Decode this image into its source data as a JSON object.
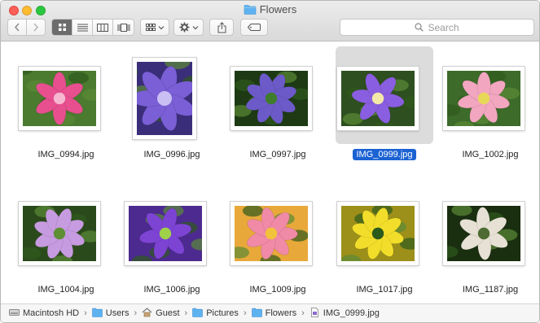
{
  "window": {
    "title": "Flowers"
  },
  "toolbar": {
    "view_modes": [
      "icon-view",
      "list-view",
      "column-view",
      "coverflow-view"
    ],
    "active_view": "icon-view"
  },
  "search": {
    "placeholder": "Search"
  },
  "files": [
    {
      "name": "IMG_0994.jpg",
      "selected": false,
      "orientation": "landscape",
      "palette": [
        "#e74f8f",
        "#f6b6cf",
        "#4a7b2f"
      ]
    },
    {
      "name": "IMG_0996.jpg",
      "selected": false,
      "orientation": "portrait",
      "palette": [
        "#7a5fd6",
        "#c9bff3",
        "#3a2e7a"
      ]
    },
    {
      "name": "IMG_0997.jpg",
      "selected": false,
      "orientation": "landscape",
      "palette": [
        "#6c5ac8",
        "#3f7d2c",
        "#1d3a14"
      ]
    },
    {
      "name": "IMG_0999.jpg",
      "selected": true,
      "orientation": "landscape",
      "palette": [
        "#8a5ee0",
        "#f2e9a8",
        "#2e4f1f"
      ]
    },
    {
      "name": "IMG_1002.jpg",
      "selected": false,
      "orientation": "landscape",
      "palette": [
        "#f2a6c0",
        "#e8d85a",
        "#3c6b2a"
      ]
    },
    {
      "name": "IMG_1004.jpg",
      "selected": false,
      "orientation": "landscape",
      "palette": [
        "#c79be0",
        "#5e8f35",
        "#2b4a1c"
      ]
    },
    {
      "name": "IMG_1006.jpg",
      "selected": false,
      "orientation": "landscape",
      "palette": [
        "#7d44d4",
        "#9fd04a",
        "#4c2a8f"
      ]
    },
    {
      "name": "IMG_1009.jpg",
      "selected": false,
      "orientation": "landscape",
      "palette": [
        "#f08aa6",
        "#f2c23a",
        "#e8a93a"
      ]
    },
    {
      "name": "IMG_1017.jpg",
      "selected": false,
      "orientation": "landscape",
      "palette": [
        "#f2de2a",
        "#2a5a1a",
        "#9c8f1a"
      ]
    },
    {
      "name": "IMG_1187.jpg",
      "selected": false,
      "orientation": "landscape",
      "palette": [
        "#e6e1d4",
        "#4d6b33",
        "#1a2e10"
      ]
    }
  ],
  "pathbar": [
    {
      "label": "Macintosh HD",
      "icon": "disk-icon"
    },
    {
      "label": "Users",
      "icon": "folder-icon"
    },
    {
      "label": "Guest",
      "icon": "home-icon"
    },
    {
      "label": "Pictures",
      "icon": "folder-icon"
    },
    {
      "label": "Flowers",
      "icon": "folder-icon"
    },
    {
      "label": "IMG_0999.jpg",
      "icon": "file-icon"
    }
  ],
  "colors": {
    "selection": "#1b62d3",
    "folder": "#5fb2f0"
  }
}
